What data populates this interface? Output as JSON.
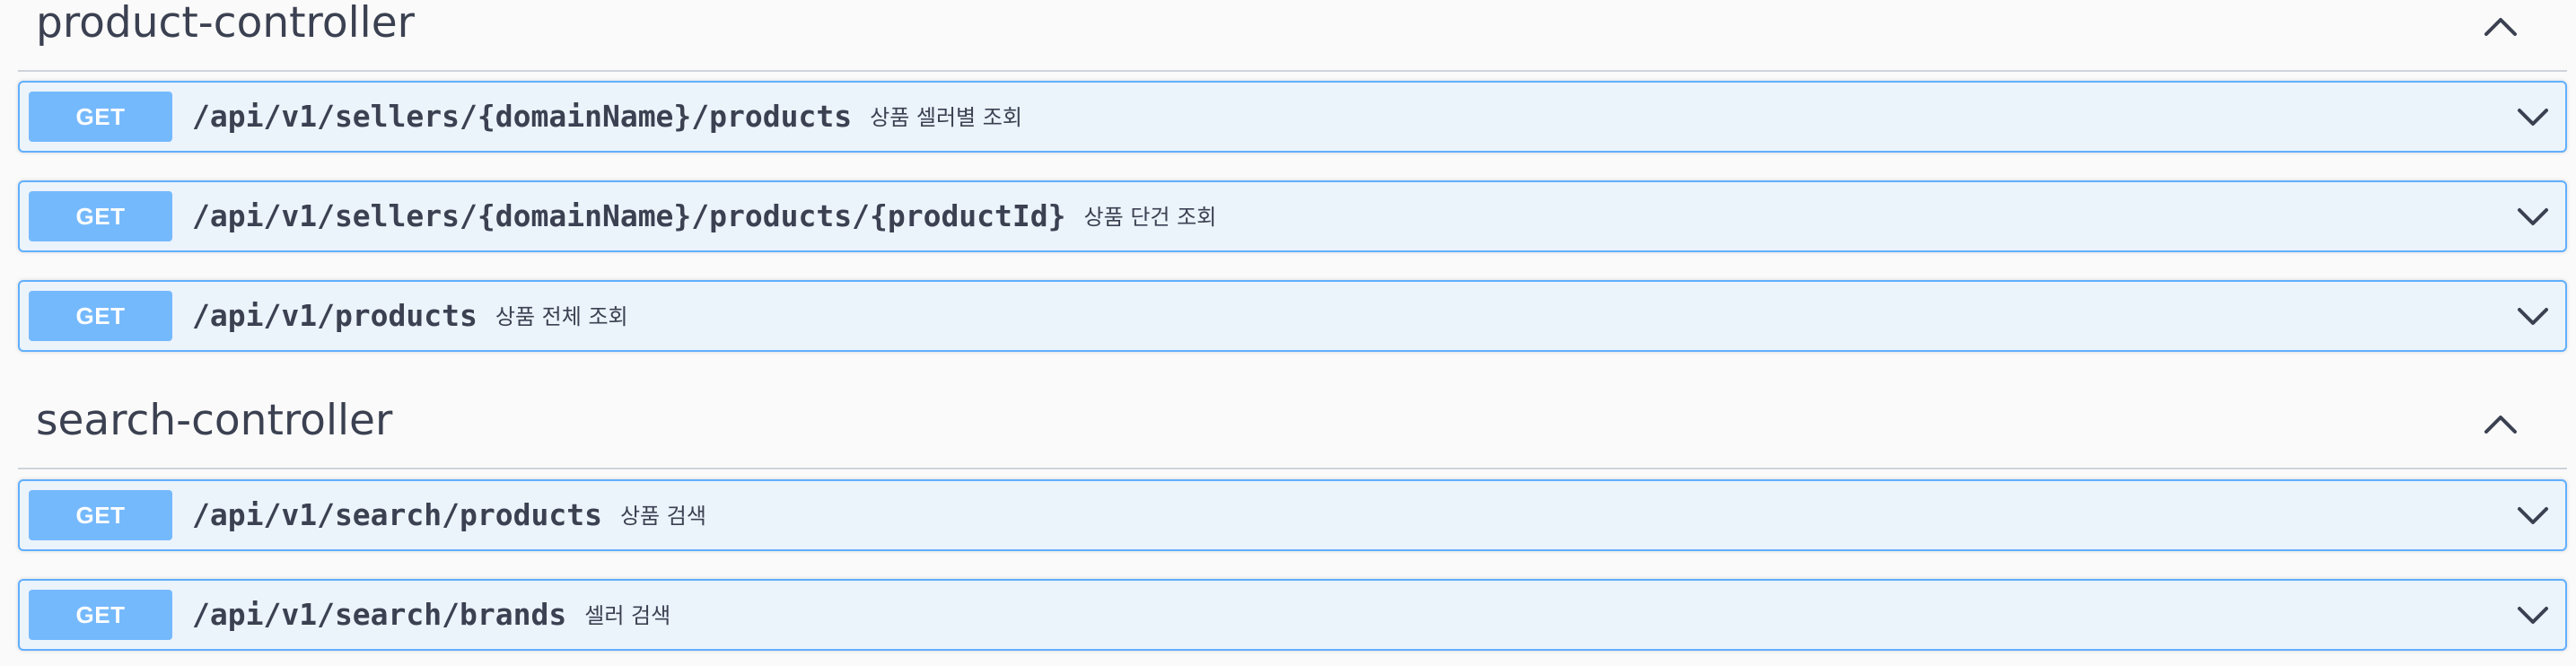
{
  "sections": [
    {
      "title": "product-controller",
      "collapse_icon": "chevron-up-icon",
      "operations": [
        {
          "method": "GET",
          "path": "/api/v1/sellers/{domainName}/products",
          "summary": "상품 셀러별 조회",
          "expand_icon": "chevron-down-icon"
        },
        {
          "method": "GET",
          "path": "/api/v1/sellers/{domainName}/products/{productId}",
          "summary": "상품 단건 조회",
          "expand_icon": "chevron-down-icon"
        },
        {
          "method": "GET",
          "path": "/api/v1/products",
          "summary": "상품 전체 조회",
          "expand_icon": "chevron-down-icon"
        }
      ]
    },
    {
      "title": "search-controller",
      "collapse_icon": "chevron-up-icon",
      "operations": [
        {
          "method": "GET",
          "path": "/api/v1/search/products",
          "summary": "상품 검색",
          "expand_icon": "chevron-down-icon"
        },
        {
          "method": "GET",
          "path": "/api/v1/search/brands",
          "summary": "셀러 검색",
          "expand_icon": "chevron-down-icon"
        }
      ]
    }
  ],
  "colors": {
    "get_accent": "#61affe",
    "get_background": "#ebf3fb",
    "text": "#3b4151",
    "page_background": "#fafafa"
  }
}
